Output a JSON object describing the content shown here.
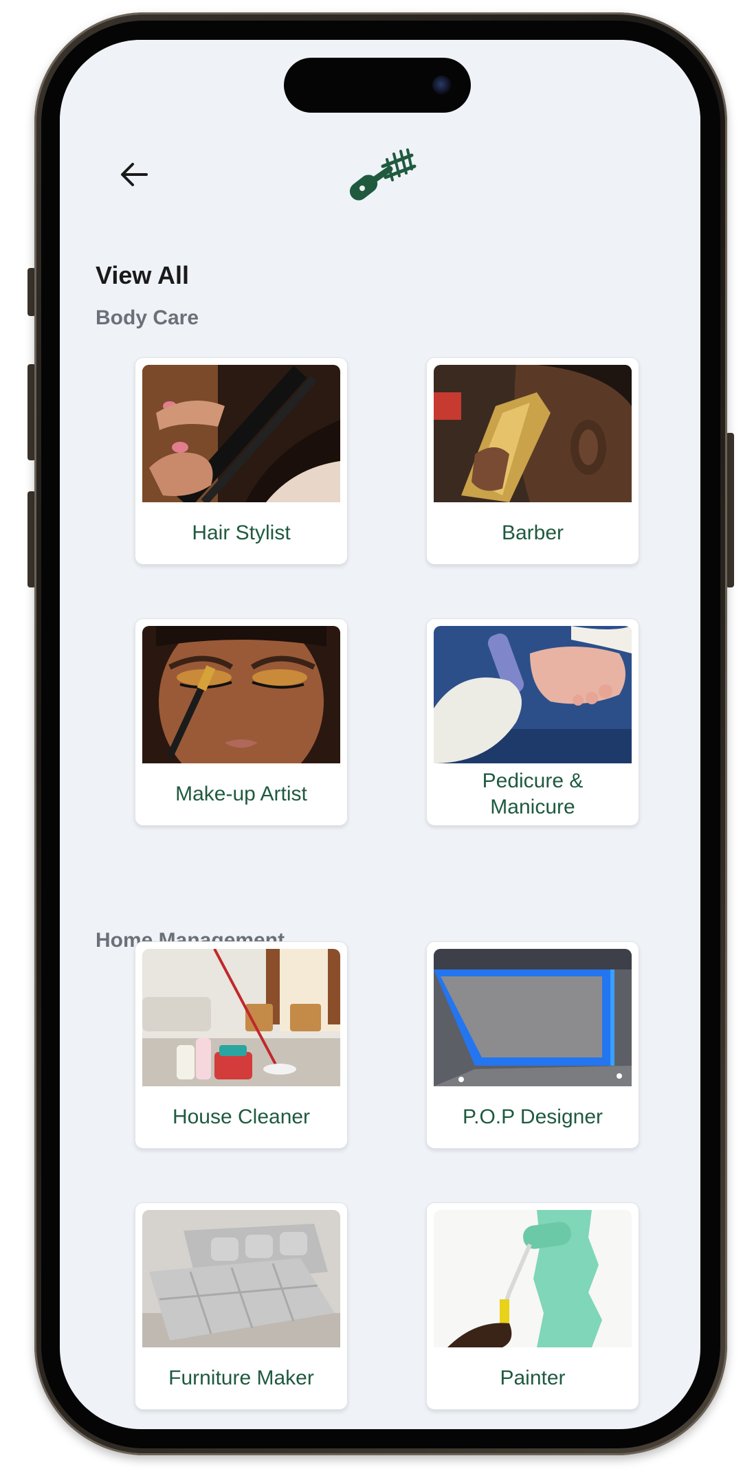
{
  "header": {
    "back_icon": "arrow-left-icon",
    "logo_icon": "clipper-logo-icon",
    "brand_color": "#1f5a3f"
  },
  "page": {
    "title": "View All"
  },
  "sections": [
    {
      "label": "Body Care",
      "services": [
        {
          "label": "Hair Stylist",
          "image": "hair-straightener-photo"
        },
        {
          "label": "Barber",
          "image": "hair-clipper-photo"
        },
        {
          "label": "Make-up Artist",
          "image": "eyeshadow-brush-photo"
        },
        {
          "label": "Pedicure & Manicure",
          "image": "foot-scrub-photo"
        }
      ]
    },
    {
      "label": "Home Management",
      "services": [
        {
          "label": "House Cleaner",
          "image": "living-room-mop-photo"
        },
        {
          "label": "P.O.P Designer",
          "image": "led-ceiling-photo"
        },
        {
          "label": "Furniture Maker",
          "image": "grey-sofa-photo"
        },
        {
          "label": "Painter",
          "image": "paint-roller-photo"
        }
      ]
    }
  ]
}
